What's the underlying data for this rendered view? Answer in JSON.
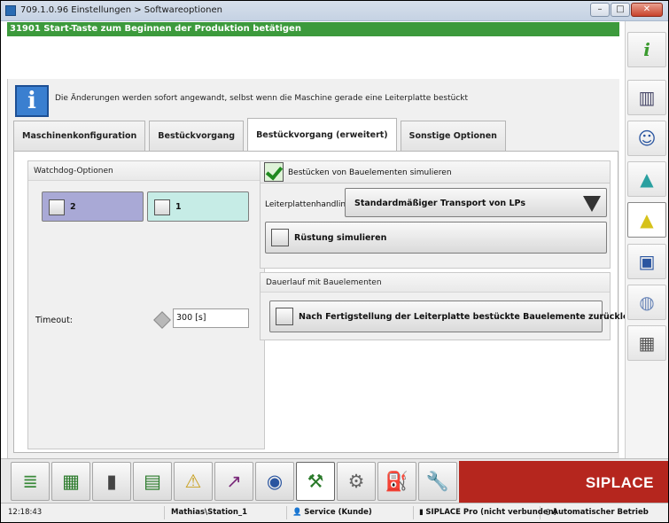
{
  "window": {
    "title": "709.1.0.96 Einstellungen > Softwareoptionen"
  },
  "message_bar": "31901 Start-Taste zum Beginnen der Produktion betätigen",
  "info": {
    "text": "Die Änderungen werden sofort angewandt, selbst wenn die Maschine gerade eine Leiterplatte bestückt"
  },
  "tabs": [
    {
      "label": "Maschinenkonfiguration",
      "active": false
    },
    {
      "label": "Bestückvorgang",
      "active": false
    },
    {
      "label": "Bestückvorgang (erweitert)",
      "active": true
    },
    {
      "label": "Sonstige Optionen",
      "active": false
    }
  ],
  "watchdog": {
    "title": "Watchdog-Optionen",
    "buttons": [
      {
        "label": "2",
        "color": "#a9a9d6"
      },
      {
        "label": "1",
        "color": "#c6ece6"
      }
    ],
    "timeout_label": "Timeout:",
    "timeout_value": "300 [s]"
  },
  "simulation": {
    "checkbox_label": "Bestücken von Bauelementen simulieren",
    "checked": true,
    "handling_label": "Leiterplattenhandling",
    "handling_value": "Standardmäßiger Transport von LPs",
    "setup_button": "Rüstung simulieren"
  },
  "continuous": {
    "title": "Dauerlauf mit Bauelementen",
    "button": "Nach Fertigstellung der Leiterplatte bestückte Bauelemente zurücklegen"
  },
  "brand": "SIPLACE",
  "status": {
    "time": "12:18:43",
    "station": "Mathias\\Station_1",
    "user": "Service (Kunde)",
    "connection": "SIPLACE Pro (nicht verbunden)",
    "mode": "Automatischer Betrieb"
  },
  "colors": {
    "message_bar": "#3c9a3c",
    "brand": "#b5261e"
  }
}
